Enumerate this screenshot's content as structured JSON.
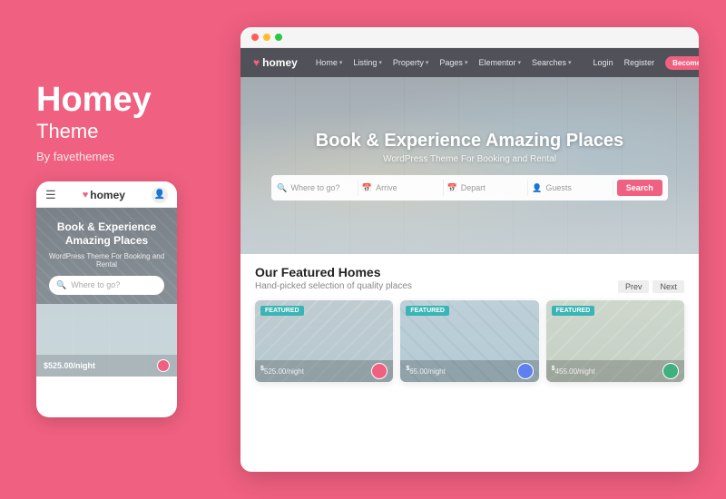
{
  "left": {
    "title": "Homey",
    "sub": "Theme",
    "by": "By favethemes"
  },
  "mobile": {
    "logo": "homey",
    "hero_title": "Book & Experience Amazing Places",
    "hero_sub": "WordPress Theme For Booking and Rental",
    "search_placeholder": "Where to go?",
    "price": "$525.00/night"
  },
  "desktop": {
    "title_bar_dots": [
      "red",
      "yellow",
      "green"
    ],
    "nav": {
      "logo": "homey",
      "items": [
        {
          "label": "Home",
          "has_dropdown": true
        },
        {
          "label": "Listing",
          "has_dropdown": true
        },
        {
          "label": "Property",
          "has_dropdown": true
        },
        {
          "label": "Pages",
          "has_dropdown": true
        },
        {
          "label": "Elementor",
          "has_dropdown": true
        },
        {
          "label": "Searches",
          "has_dropdown": true
        },
        {
          "label": "Login",
          "has_dropdown": false
        },
        {
          "label": "Register",
          "has_dropdown": false
        }
      ],
      "cta": "Become a Host"
    },
    "hero": {
      "title": "Book & Experience Amazing Places",
      "sub": "WordPress Theme For Booking and Rental",
      "search": {
        "where_placeholder": "Where to go?",
        "arrive_placeholder": "Arrive",
        "depart_placeholder": "Depart",
        "guests_placeholder": "Guests",
        "btn": "Search"
      }
    },
    "section": {
      "title": "Our Featured Homes",
      "sub": "Hand-picked selection of quality places",
      "prev_label": "Prev",
      "next_label": "Next"
    },
    "properties": [
      {
        "badge": "FEATURED",
        "price_sup": "$",
        "price": "525.00",
        "unit": "/night"
      },
      {
        "badge": "FEATURED",
        "price_sup": "$",
        "price": "65.00",
        "unit": "/night"
      },
      {
        "badge": "FEATURED",
        "price_sup": "$",
        "price": "455.00",
        "unit": "/night"
      }
    ]
  }
}
